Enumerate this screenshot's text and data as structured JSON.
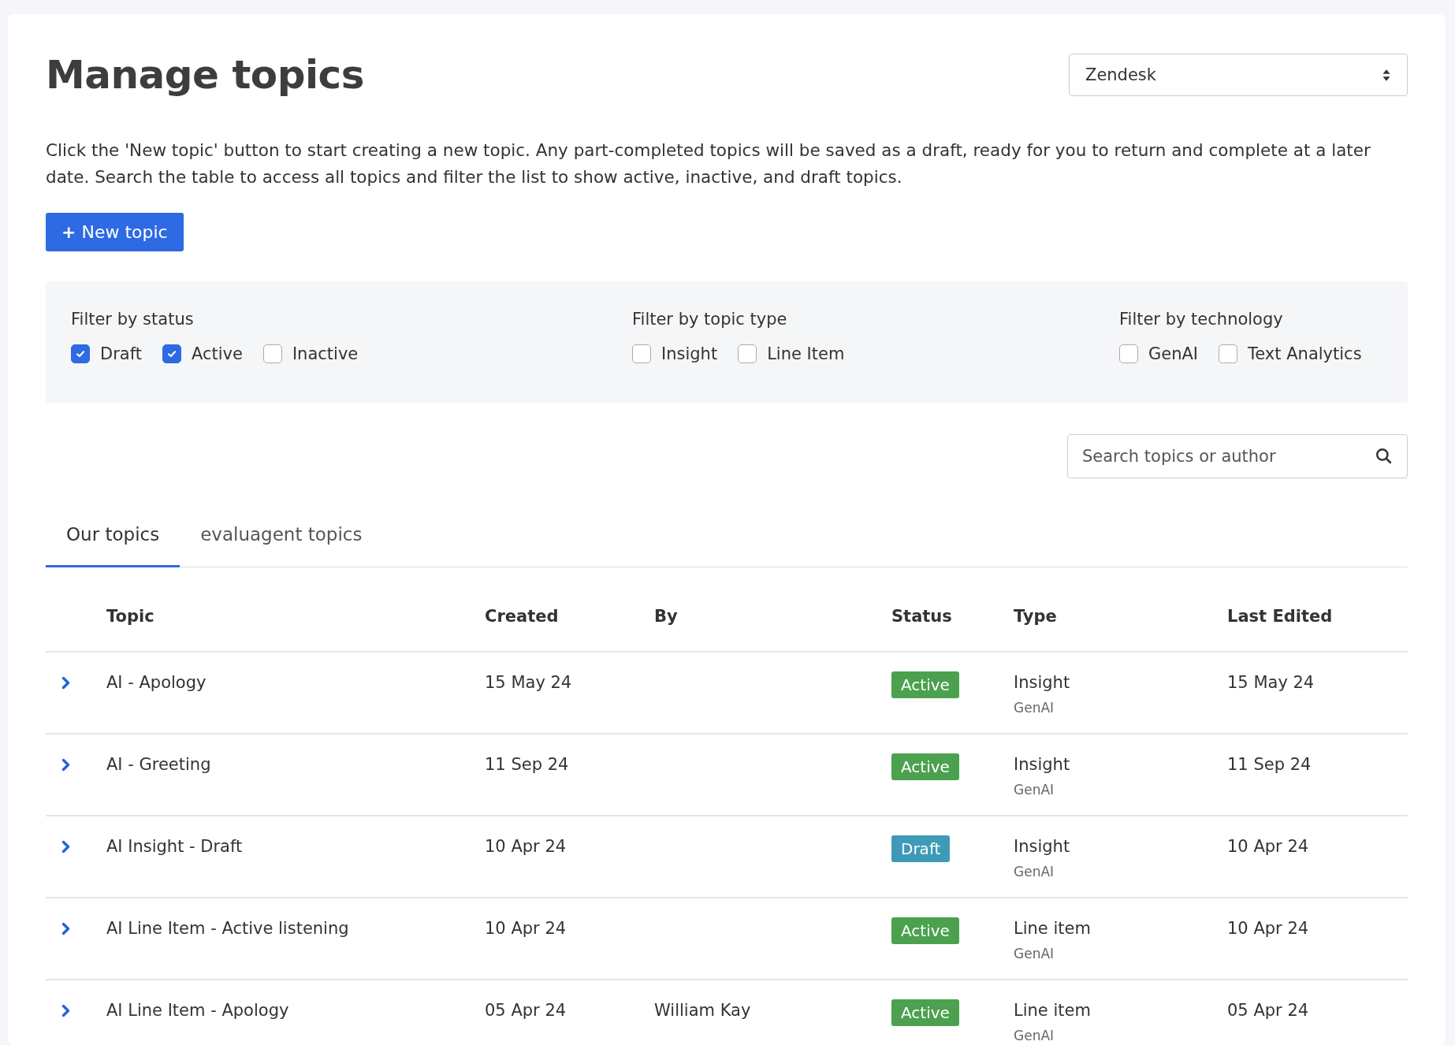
{
  "title": "Manage topics",
  "source_select": {
    "value": "Zendesk"
  },
  "description": "Click the 'New topic' button to start creating a new topic. Any part-completed topics will be saved as a draft, ready for you to return and complete at a later date. Search the table to access all topics and filter the list to show active, inactive, and draft topics.",
  "new_button": {
    "icon": "+",
    "label": "New topic"
  },
  "filters": [
    {
      "label": "Filter by status",
      "options": [
        {
          "label": "Draft",
          "checked": true
        },
        {
          "label": "Active",
          "checked": true
        },
        {
          "label": "Inactive",
          "checked": false
        }
      ]
    },
    {
      "label": "Filter by topic type",
      "options": [
        {
          "label": "Insight",
          "checked": false
        },
        {
          "label": "Line Item",
          "checked": false
        }
      ]
    },
    {
      "label": "Filter by technology",
      "options": [
        {
          "label": "GenAI",
          "checked": false
        },
        {
          "label": "Text Analytics",
          "checked": false
        }
      ]
    }
  ],
  "search": {
    "placeholder": "Search topics or author"
  },
  "tabs": [
    {
      "label": "Our topics",
      "selected": true
    },
    {
      "label": "evaluagent topics",
      "selected": false
    }
  ],
  "table": {
    "columns": [
      "Topic",
      "Created",
      "By",
      "Status",
      "Type",
      "Last Edited"
    ],
    "rows": [
      {
        "topic": "AI - Apology",
        "created": "15 May 24",
        "status": {
          "label": "Active",
          "kind": "active"
        },
        "type": "Insight",
        "technology": "GenAI",
        "last_edited": "15 May 24"
      },
      {
        "topic": "AI - Greeting",
        "created": "11 Sep 24",
        "status": {
          "label": "Active",
          "kind": "active"
        },
        "type": "Insight",
        "technology": "GenAI",
        "last_edited": "11 Sep 24"
      },
      {
        "topic": "AI Insight - Draft",
        "created": "10 Apr 24",
        "status": {
          "label": "Draft",
          "kind": "draft"
        },
        "type": "Insight",
        "technology": "GenAI",
        "last_edited": "10 Apr 24"
      },
      {
        "topic": "AI Line Item - Active listening",
        "created": "10 Apr 24",
        "status": {
          "label": "Active",
          "kind": "active"
        },
        "type": "Line item",
        "technology": "GenAI",
        "last_edited": "10 Apr 24"
      },
      {
        "topic": "AI Line Item - Apology",
        "created": "05 Apr 24",
        "by": "William Kay",
        "status": {
          "label": "Active",
          "kind": "active"
        },
        "type": "Line item",
        "technology": "GenAI",
        "last_edited": "05 Apr 24"
      }
    ]
  }
}
